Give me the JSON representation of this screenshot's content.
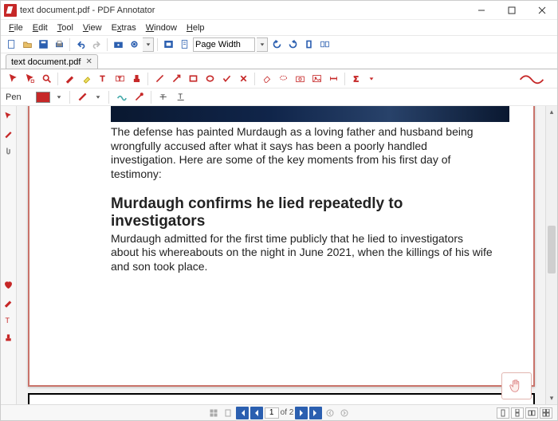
{
  "title": "text document.pdf - PDF Annotator",
  "menus": [
    "File",
    "Edit",
    "Tool",
    "View",
    "Extras",
    "Window",
    "Help"
  ],
  "zoom": "Page Width",
  "tab": {
    "label": "text document.pdf"
  },
  "pen_label": "Pen",
  "page": {
    "p1": "The defense has painted Murdaugh as a loving father and husband being wrongfully accused after what it says has been a poorly handled investigation. Here are some of the key moments from his first day of testimony:",
    "h3": "Murdaugh confirms he lied repeatedly to investigators",
    "p2": "Murdaugh admitted for the first time publicly that he lied to investigators about his whereabouts on the night in June 2021, when the killings of his wife and son took place."
  },
  "nav": {
    "current": "1",
    "total": "of 2"
  }
}
